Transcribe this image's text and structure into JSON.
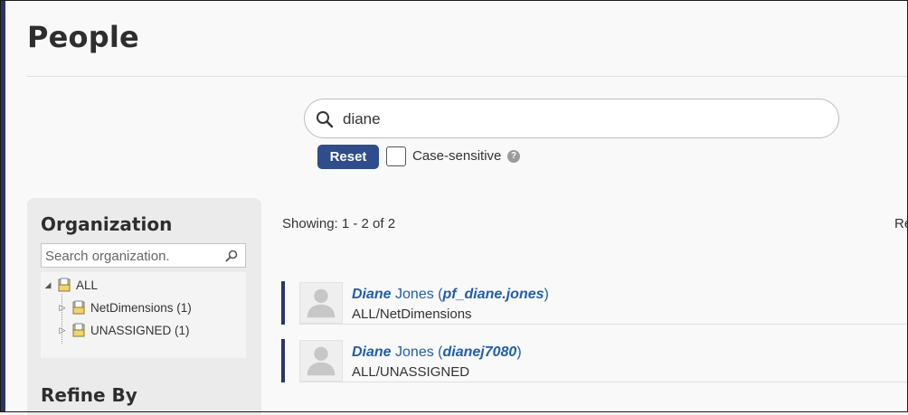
{
  "page": {
    "title": "People"
  },
  "search": {
    "value": "diane"
  },
  "controls": {
    "reset_label": "Reset",
    "case_sensitive_label": "Case-sensitive",
    "help_glyph": "?"
  },
  "sidebar": {
    "organization_title": "Organization",
    "organization_search_placeholder": "Search organization.",
    "tree": [
      {
        "label": "ALL",
        "expanded": true,
        "toggle": "◢"
      },
      {
        "label": "NetDimensions (1)",
        "expanded": false,
        "toggle": "▷"
      },
      {
        "label": "UNASSIGNED (1)",
        "expanded": false,
        "toggle": "▷"
      }
    ],
    "refine_title": "Refine By"
  },
  "results": {
    "showing": "Showing: 1 - 2 of 2",
    "right_cut_label": "Re",
    "items": [
      {
        "first": "Diane",
        "last": " Jones",
        "open": " (",
        "username": "pf_diane.jones",
        "close": ")",
        "path": "ALL/NetDimensions"
      },
      {
        "first": "Diane",
        "last": " Jones",
        "open": " (",
        "username": "dianej7080",
        "close": ")",
        "path": "ALL/UNASSIGNED"
      }
    ]
  },
  "icons": {
    "search": "search-icon",
    "org_search": "magnifier-icon",
    "avatar": "user-placeholder-icon",
    "folder": "folder-icon"
  },
  "colors": {
    "accent": "#2d3467",
    "button": "#2e4d8a",
    "link": "#1f5fa8"
  }
}
